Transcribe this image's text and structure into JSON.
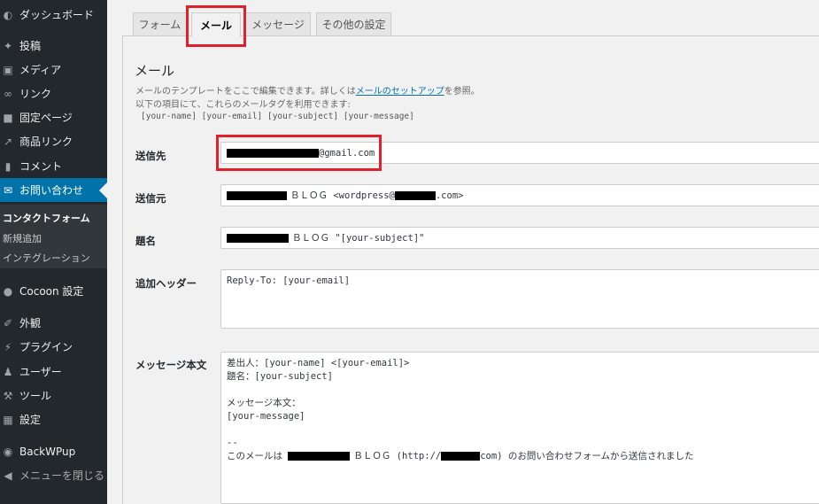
{
  "sidebar": {
    "items": [
      {
        "label": "ダッシュボード",
        "icon": "dashboard-icon"
      },
      {
        "label": "投稿",
        "icon": "pin-icon"
      },
      {
        "label": "メディア",
        "icon": "media-icon"
      },
      {
        "label": "リンク",
        "icon": "link-icon"
      },
      {
        "label": "固定ページ",
        "icon": "page-icon"
      },
      {
        "label": "商品リンク",
        "icon": "share-icon"
      },
      {
        "label": "コメント",
        "icon": "comment-icon"
      },
      {
        "label": "お問い合わせ",
        "icon": "mail-icon"
      },
      {
        "label": "Cocoon 設定",
        "icon": "cocoon-icon"
      },
      {
        "label": "外観",
        "icon": "brush-icon"
      },
      {
        "label": "プラグイン",
        "icon": "plugin-icon"
      },
      {
        "label": "ユーザー",
        "icon": "user-icon"
      },
      {
        "label": "ツール",
        "icon": "wrench-icon"
      },
      {
        "label": "設定",
        "icon": "settings-icon"
      },
      {
        "label": "BackWPup",
        "icon": "backwpup-icon"
      },
      {
        "label": "メニューを閉じる",
        "icon": "collapse-icon"
      }
    ],
    "submenu": [
      "コンタクトフォーム",
      "新規追加",
      "インテグレーション"
    ]
  },
  "tabs": [
    "フォーム",
    "メール",
    "メッセージ",
    "その他の設定"
  ],
  "mail": {
    "title": "メール",
    "desc_line1_before": "メールのテンプレートをここで編集できます。詳しくは",
    "desc_link": "メールのセットアップ",
    "desc_line1_after": "を参照。",
    "desc_line2": "以下の項目にて、これらのメールタグを利用できます:",
    "tags": "[your-name] [your-email] [your-subject] [your-message]",
    "to_label": "送信先",
    "to_value": "@gmail.com",
    "from_label": "送信元",
    "from_value_mid": "ＢＬＯＧ <wordpress@",
    "from_value_end": ".com>",
    "subject_label": "題名",
    "subject_value": "ＢＬＯＧ \"[your-subject]\"",
    "headers_label": "追加ヘッダー",
    "headers_value": "Reply-To: [your-email]",
    "body_label": "メッセージ本文",
    "body_line1": "差出人：[your-name] <[your-email]>",
    "body_line2": "題名：[your-subject]",
    "body_line3": "メッセージ本文：",
    "body_line4": "[your-message]",
    "body_line5": "--",
    "body_line6_a": "このメールは ",
    "body_line6_b": "ＢＬＯＧ (http://",
    "body_line6_c": "com) のお問い合わせフォームから送信されました"
  },
  "colors": {
    "accent": "#0073aa",
    "highlight": "#e0202b",
    "sidebar": "#23282d"
  }
}
